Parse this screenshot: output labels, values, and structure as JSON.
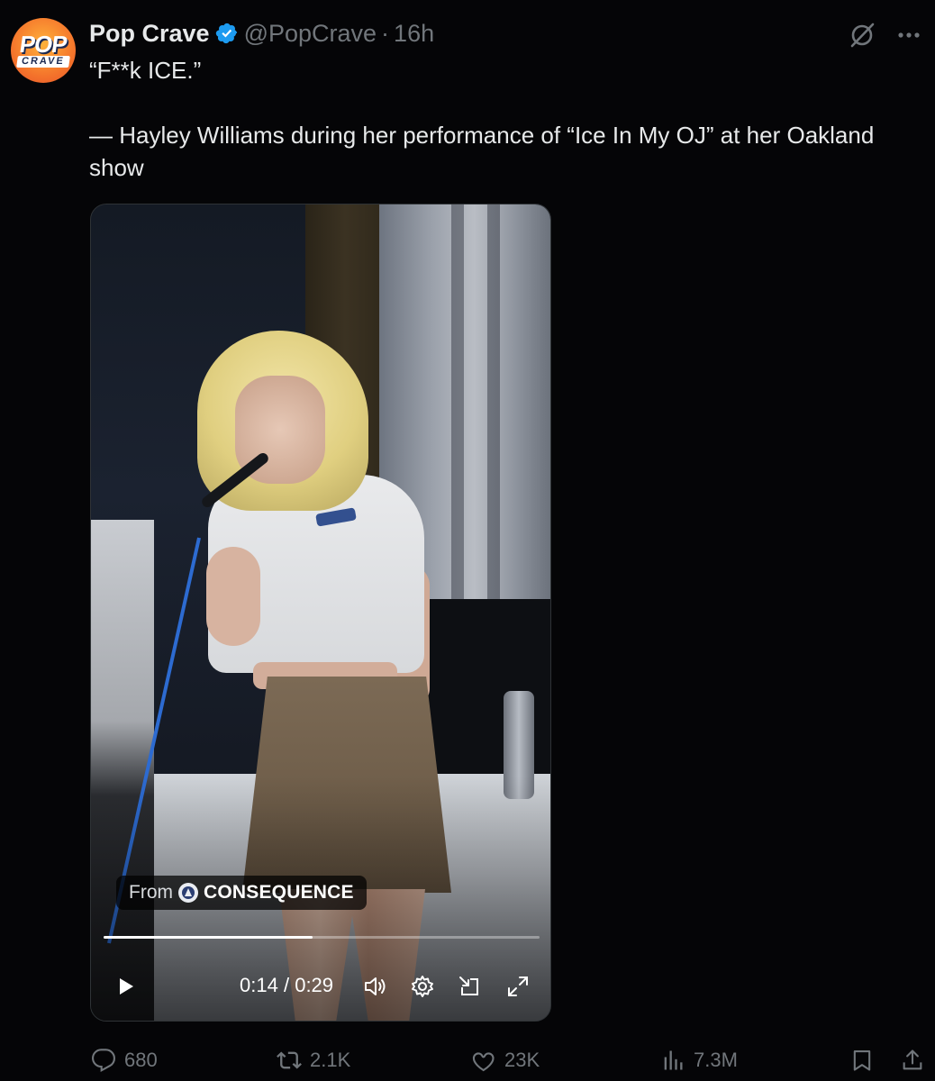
{
  "author": {
    "display_name": "Pop Crave",
    "handle": "@PopCrave",
    "separator": "·",
    "time": "16h",
    "avatar_text_top": "POP",
    "avatar_text_bottom": "CRAVE",
    "verified": true
  },
  "tweet": {
    "line1": "“F**k ICE.”",
    "line2": "— Hayley Williams during her performance of “Ice In My OJ” at her Oakland show"
  },
  "video": {
    "source_prefix": "From",
    "source_name": "CONSEQUENCE",
    "current_time": "0:14",
    "time_separator": "/",
    "duration": "0:29",
    "progress": 0.48
  },
  "actions": {
    "replies": "680",
    "reposts": "2.1K",
    "likes": "23K",
    "views": "7.3M"
  },
  "colors": {
    "background": "#050507",
    "text_primary": "#e7e9ea",
    "text_secondary": "#71767b",
    "verified_blue": "#1d9bf0"
  },
  "icons": {
    "verified": "verified-badge-icon",
    "grok": "grok-icon",
    "more": "more-icon",
    "play": "play-icon",
    "volume": "volume-icon",
    "settings": "settings-icon",
    "minimize": "minimize-icon",
    "fullscreen": "fullscreen-icon",
    "reply": "reply-icon",
    "repost": "repost-icon",
    "like": "like-icon",
    "views": "views-icon",
    "bookmark": "bookmark-icon",
    "share": "share-icon"
  }
}
